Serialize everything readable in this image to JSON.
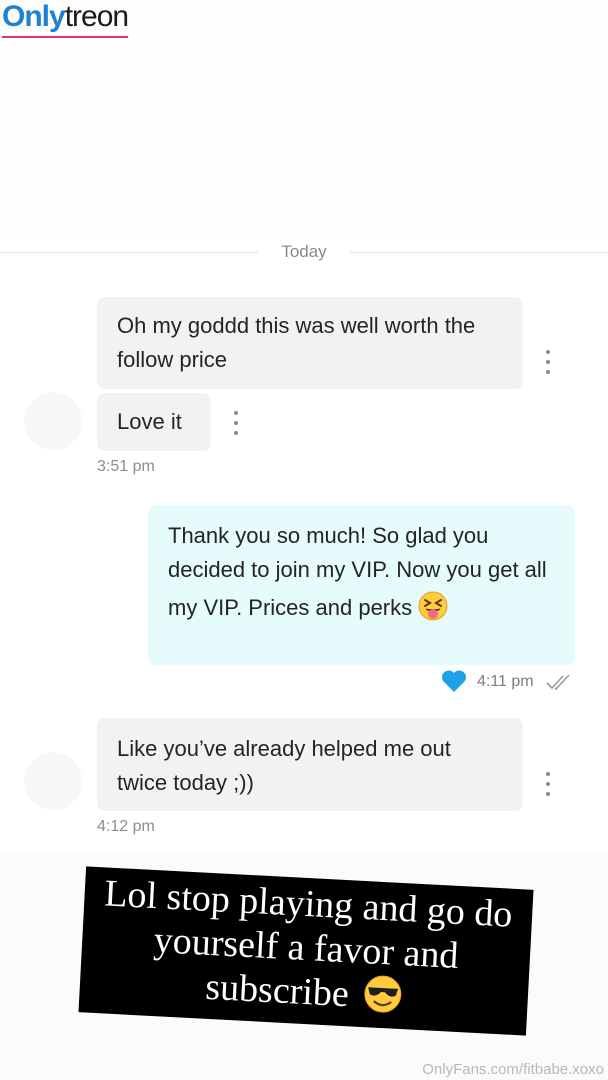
{
  "watermark": {
    "logo_part1": "Only",
    "logo_part2": "treon",
    "footer": "OnlyFans.com/fitbabe.xoxo"
  },
  "separator": {
    "label": "Today"
  },
  "messages": [
    {
      "direction": "incoming",
      "text": "Oh my goddd this was well worth the follow price"
    },
    {
      "direction": "incoming",
      "text": "Love it",
      "time": "3:51 pm"
    },
    {
      "direction": "outgoing",
      "text": "Thank you so much! So glad you decided to join my VIP. Now you get all my VIP. Prices and perks",
      "emoji": "squinting-tongue-face",
      "time": "4:11 pm",
      "liked": true,
      "read": true
    },
    {
      "direction": "incoming",
      "text": "Like you’ve already helped me out twice today ;))",
      "time": "4:12 pm"
    }
  ],
  "banner": {
    "text": "Lol stop playing and go do yourself a favor and subscribe",
    "emoji": "smiling-face-with-sunglasses"
  },
  "colors": {
    "incoming_bubble": "#f2f2f2",
    "outgoing_bubble": "#e5fbfc",
    "like_heart": "#1da1e8",
    "logo_blue": "#1d82d2",
    "logo_underline": "#d9367a"
  }
}
